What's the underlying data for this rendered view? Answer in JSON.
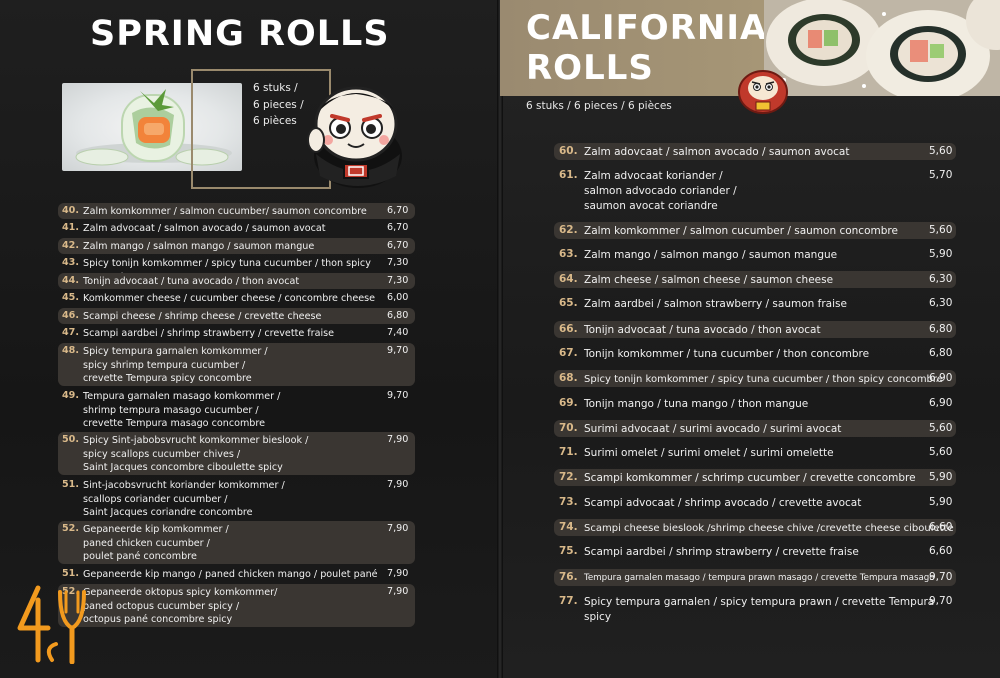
{
  "left": {
    "title": "SPRING ROLLS",
    "pieces": [
      "6 stuks /",
      "6 pieces /",
      "6 pièces"
    ],
    "items": [
      {
        "num": "40.",
        "desc": "Zalm komkommer / salmon cucumber/ saumon concombre",
        "price": "6,70",
        "hl": true
      },
      {
        "num": "41.",
        "desc": "Zalm advocaat / salmon avocado / saumon avocat",
        "price": "6,70",
        "hl": false
      },
      {
        "num": "42.",
        "desc": "Zalm mango / salmon mango / saumon mangue",
        "price": "6,70",
        "hl": true
      },
      {
        "num": "43.",
        "desc": "Spicy tonijn komkommer / spicy tuna cucumber / thon spicy concombre",
        "price": "7,30",
        "hl": false
      },
      {
        "num": "44.",
        "desc": "Tonijn advocaat / tuna avocado / thon avocat",
        "price": "7,30",
        "hl": true
      },
      {
        "num": "45.",
        "desc": " Komkommer cheese / cucumber cheese / concombre cheese",
        "price": "6,00",
        "hl": false
      },
      {
        "num": "46.",
        "desc": "Scampi cheese / shrimp cheese / crevette cheese",
        "price": "6,80",
        "hl": true
      },
      {
        "num": "47.",
        "desc": "Scampi aardbei / shrimp strawberry / crevette fraise",
        "price": "7,40",
        "hl": false
      },
      {
        "num": "48.",
        "desc": "Spicy tempura garnalen komkommer /\nspicy shrimp tempura cucumber /\ncrevette Tempura spicy concombre",
        "price": "9,70",
        "hl": true
      },
      {
        "num": "49.",
        "desc": "Tempura garnalen masago komkommer /\nshrimp tempura masago cucumber /\ncrevette Tempura masago concombre",
        "price": "9,70",
        "hl": false
      },
      {
        "num": "50.",
        "desc": "Spicy Sint-jabobsvrucht komkommer bieslook /\nspicy scallops cucumber chives /\nSaint Jacques concombre ciboulette spicy",
        "price": "7,90",
        "hl": true
      },
      {
        "num": "51.",
        "desc": "Sint-jacobsvrucht koriander komkommer /\nscallops coriander cucumber /\nSaint Jacques coriandre concombre",
        "price": "7,90",
        "hl": false
      },
      {
        "num": "52.",
        "desc": "Gepaneerde kip komkommer /\npaned chicken cucumber /\npoulet pané concombre",
        "price": "7,90",
        "hl": true
      },
      {
        "num": "51.",
        "desc": "Gepaneerde kip mango / paned chicken mango / poulet pané mangue",
        "price": "7,90",
        "hl": false
      },
      {
        "num": "52.",
        "desc": "Gepaneerde oktopus spicy komkommer/\npaned octopus cucumber spicy /\noctopus pané concombre spicy",
        "price": "7,90",
        "hl": true
      }
    ]
  },
  "right": {
    "title_line1": "CALIFORNIA",
    "title_line2": "ROLLS",
    "pieces": "6 stuks / 6 pieces / 6 pièces",
    "items": [
      {
        "num": "60.",
        "desc": "Zalm adovcaat / salmon avocado / saumon avocat",
        "price": "5,60",
        "hl": true
      },
      {
        "num": "61.",
        "desc": "Zalm advocaat koriander /\nsalmon advocado coriander /\nsaumon avocat coriandre",
        "price": "5,70",
        "hl": false
      },
      {
        "num": "62.",
        "desc": "Zalm komkommer / salmon cucumber / saumon concombre",
        "price": "5,60",
        "hl": true
      },
      {
        "num": "63.",
        "desc": "Zalm mango / salmon mango / saumon mangue",
        "price": "5,90",
        "hl": false
      },
      {
        "num": "64.",
        "desc": "Zalm cheese / salmon cheese / saumon cheese",
        "price": "6,30",
        "hl": true
      },
      {
        "num": "65.",
        "desc": "Zalm aardbei / salmon strawberry / saumon fraise",
        "price": "6,30",
        "hl": false
      },
      {
        "num": "66.",
        "desc": "Tonijn advocaat / tuna avocado / thon avocat",
        "price": "6,80",
        "hl": true
      },
      {
        "num": "67.",
        "desc": "Tonijn komkommer / tuna cucumber / thon concombre",
        "price": "6,80",
        "hl": false
      },
      {
        "num": "68.",
        "desc": "Spicy tonijn komkommer / spicy tuna cucumber / thon spicy concombre",
        "price": "6,90",
        "hl": true
      },
      {
        "num": "69.",
        "desc": "Tonijn mango / tuna mango / thon mangue",
        "price": "6,90",
        "hl": false
      },
      {
        "num": "70.",
        "desc": "Surimi advocaat / surimi avocado / surimi avocat",
        "price": "5,60",
        "hl": true
      },
      {
        "num": "71.",
        "desc": "Surimi omelet / surimi omelet / surimi omelette",
        "price": "5,60",
        "hl": false
      },
      {
        "num": "72.",
        "desc": "Scampi komkommer / schrimp cucumber / crevette concombre",
        "price": "5,90",
        "hl": true
      },
      {
        "num": "73.",
        "desc": "Scampi advocaat / shrimp avocado / crevette avocat",
        "price": "5,90",
        "hl": false
      },
      {
        "num": "74.",
        "desc": "Scampi cheese bieslook /shrimp cheese chive /crevette cheese ciboulette",
        "price": "6,60",
        "hl": true
      },
      {
        "num": "75.",
        "desc": "Scampi aardbei / shrimp strawberry / crevette fraise",
        "price": "6,60",
        "hl": false
      },
      {
        "num": "76.",
        "desc": "Tempura garnalen masago / tempura prawn masago / crevette Tempura masago",
        "price": "9,70",
        "hl": true
      },
      {
        "num": "77.",
        "desc": "Spicy tempura garnalen / spicy tempura prawn / crevette Tempura spicy",
        "price": "9,70",
        "hl": false
      }
    ]
  },
  "logo": {
    "text": "4SL"
  },
  "colors": {
    "accent": "#d9b98a",
    "title_box": "#a09070",
    "highlight": "#3a3632"
  }
}
